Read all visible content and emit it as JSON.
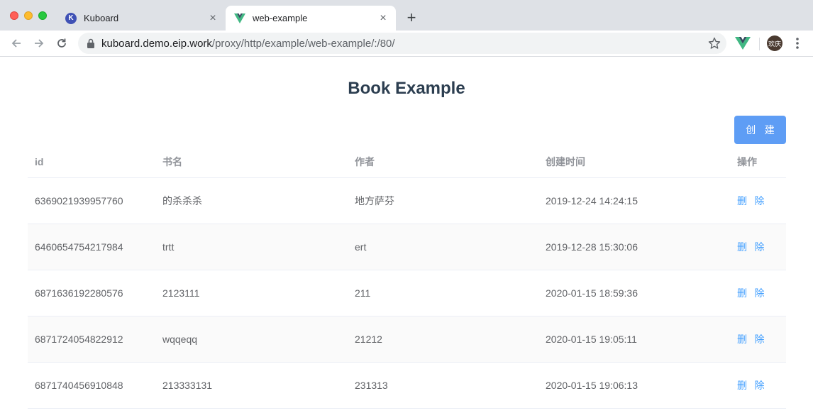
{
  "browser": {
    "tabs": [
      {
        "title": "Kuboard",
        "favicon": "K",
        "active": false
      },
      {
        "title": "web-example",
        "active": true
      }
    ],
    "url_host": "kuboard.demo.eip.work",
    "url_path": "/proxy/http/example/web-example/:/80/",
    "profile_label": "欢庆"
  },
  "page": {
    "title": "Book Example",
    "create_label": "创 建",
    "columns": {
      "id": "id",
      "name": "书名",
      "author": "作者",
      "time": "创建时间",
      "op": "操作"
    },
    "delete_label": "删 除",
    "rows": [
      {
        "id": "6369021939957760",
        "name": "的杀杀杀",
        "author": "地方萨芬",
        "time": "2019-12-24 14:24:15"
      },
      {
        "id": "6460654754217984",
        "name": "trtt",
        "author": "ert",
        "time": "2019-12-28 15:30:06"
      },
      {
        "id": "6871636192280576",
        "name": "2123111",
        "author": "211",
        "time": "2020-01-15 18:59:36"
      },
      {
        "id": "6871724054822912",
        "name": "wqqeqq",
        "author": "21212",
        "time": "2020-01-15 19:05:11"
      },
      {
        "id": "6871740456910848",
        "name": "213333131",
        "author": "231313",
        "time": "2020-01-15 19:06:13"
      }
    ]
  },
  "colors": {
    "accent": "#409eff",
    "button": "#5e9df5",
    "title": "#2c3e50"
  }
}
